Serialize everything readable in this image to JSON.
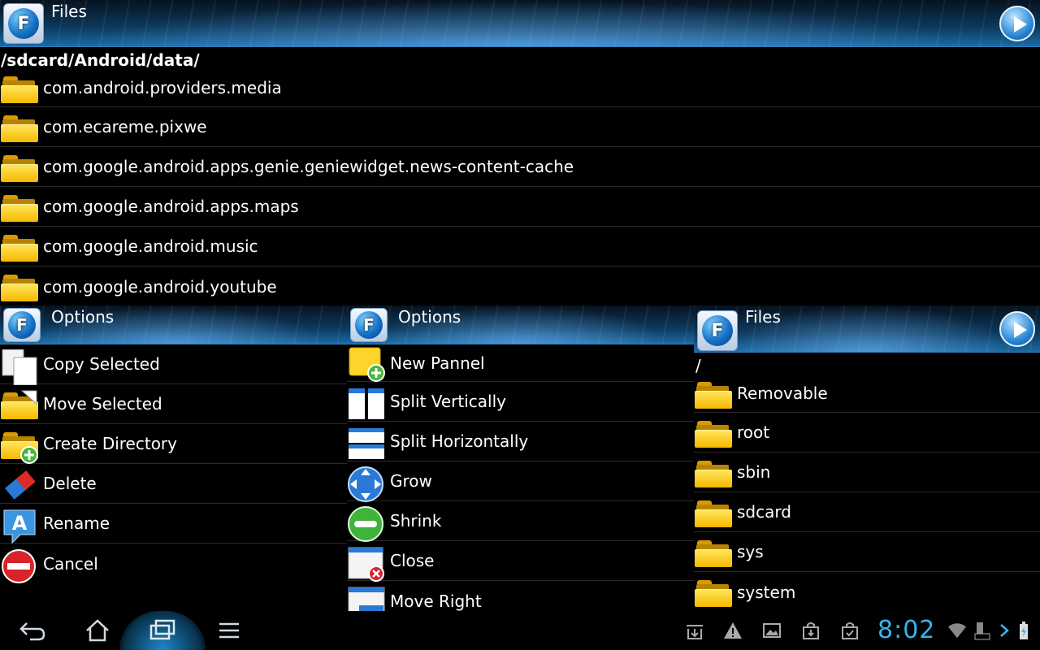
{
  "top_panel": {
    "title": "Files",
    "logo_letter": "F",
    "path": "/sdcard/Android/data/",
    "items": [
      {
        "label": "com.android.providers.media"
      },
      {
        "label": "com.ecareme.pixwe"
      },
      {
        "label": "com.google.android.apps.genie.geniewidget.news-content-cache"
      },
      {
        "label": "com.google.android.apps.maps"
      },
      {
        "label": "com.google.android.music"
      },
      {
        "label": "com.google.android.youtube"
      }
    ]
  },
  "options_left": {
    "title": "Options",
    "logo_letter": "F",
    "items": [
      {
        "label": "Copy Selected",
        "icon": "copy-icon"
      },
      {
        "label": "Move Selected",
        "icon": "move-folder-icon"
      },
      {
        "label": "Create Directory",
        "icon": "create-folder-icon"
      },
      {
        "label": "Delete",
        "icon": "eraser-icon"
      },
      {
        "label": "Rename",
        "icon": "rename-icon"
      },
      {
        "label": "Cancel",
        "icon": "cancel-icon"
      }
    ]
  },
  "options_mid": {
    "title": "Options",
    "logo_letter": "F",
    "items": [
      {
        "label": "New Pannel",
        "icon": "new-panel-icon"
      },
      {
        "label": "Split Vertically",
        "icon": "split-vertical-icon"
      },
      {
        "label": "Split Horizontally",
        "icon": "split-horizontal-icon"
      },
      {
        "label": "Grow",
        "icon": "grow-icon"
      },
      {
        "label": "Shrink",
        "icon": "shrink-icon"
      },
      {
        "label": "Close",
        "icon": "close-panel-icon"
      },
      {
        "label": "Move Right",
        "icon": "move-right-icon"
      }
    ]
  },
  "right_panel": {
    "title": "Files",
    "logo_letter": "F",
    "path": "/",
    "items": [
      {
        "label": "Removable"
      },
      {
        "label": "root"
      },
      {
        "label": "sbin"
      },
      {
        "label": "sdcard"
      },
      {
        "label": "sys"
      },
      {
        "label": "system"
      }
    ]
  },
  "system_bar": {
    "clock": "8:02",
    "accent": "#35b5ee"
  }
}
